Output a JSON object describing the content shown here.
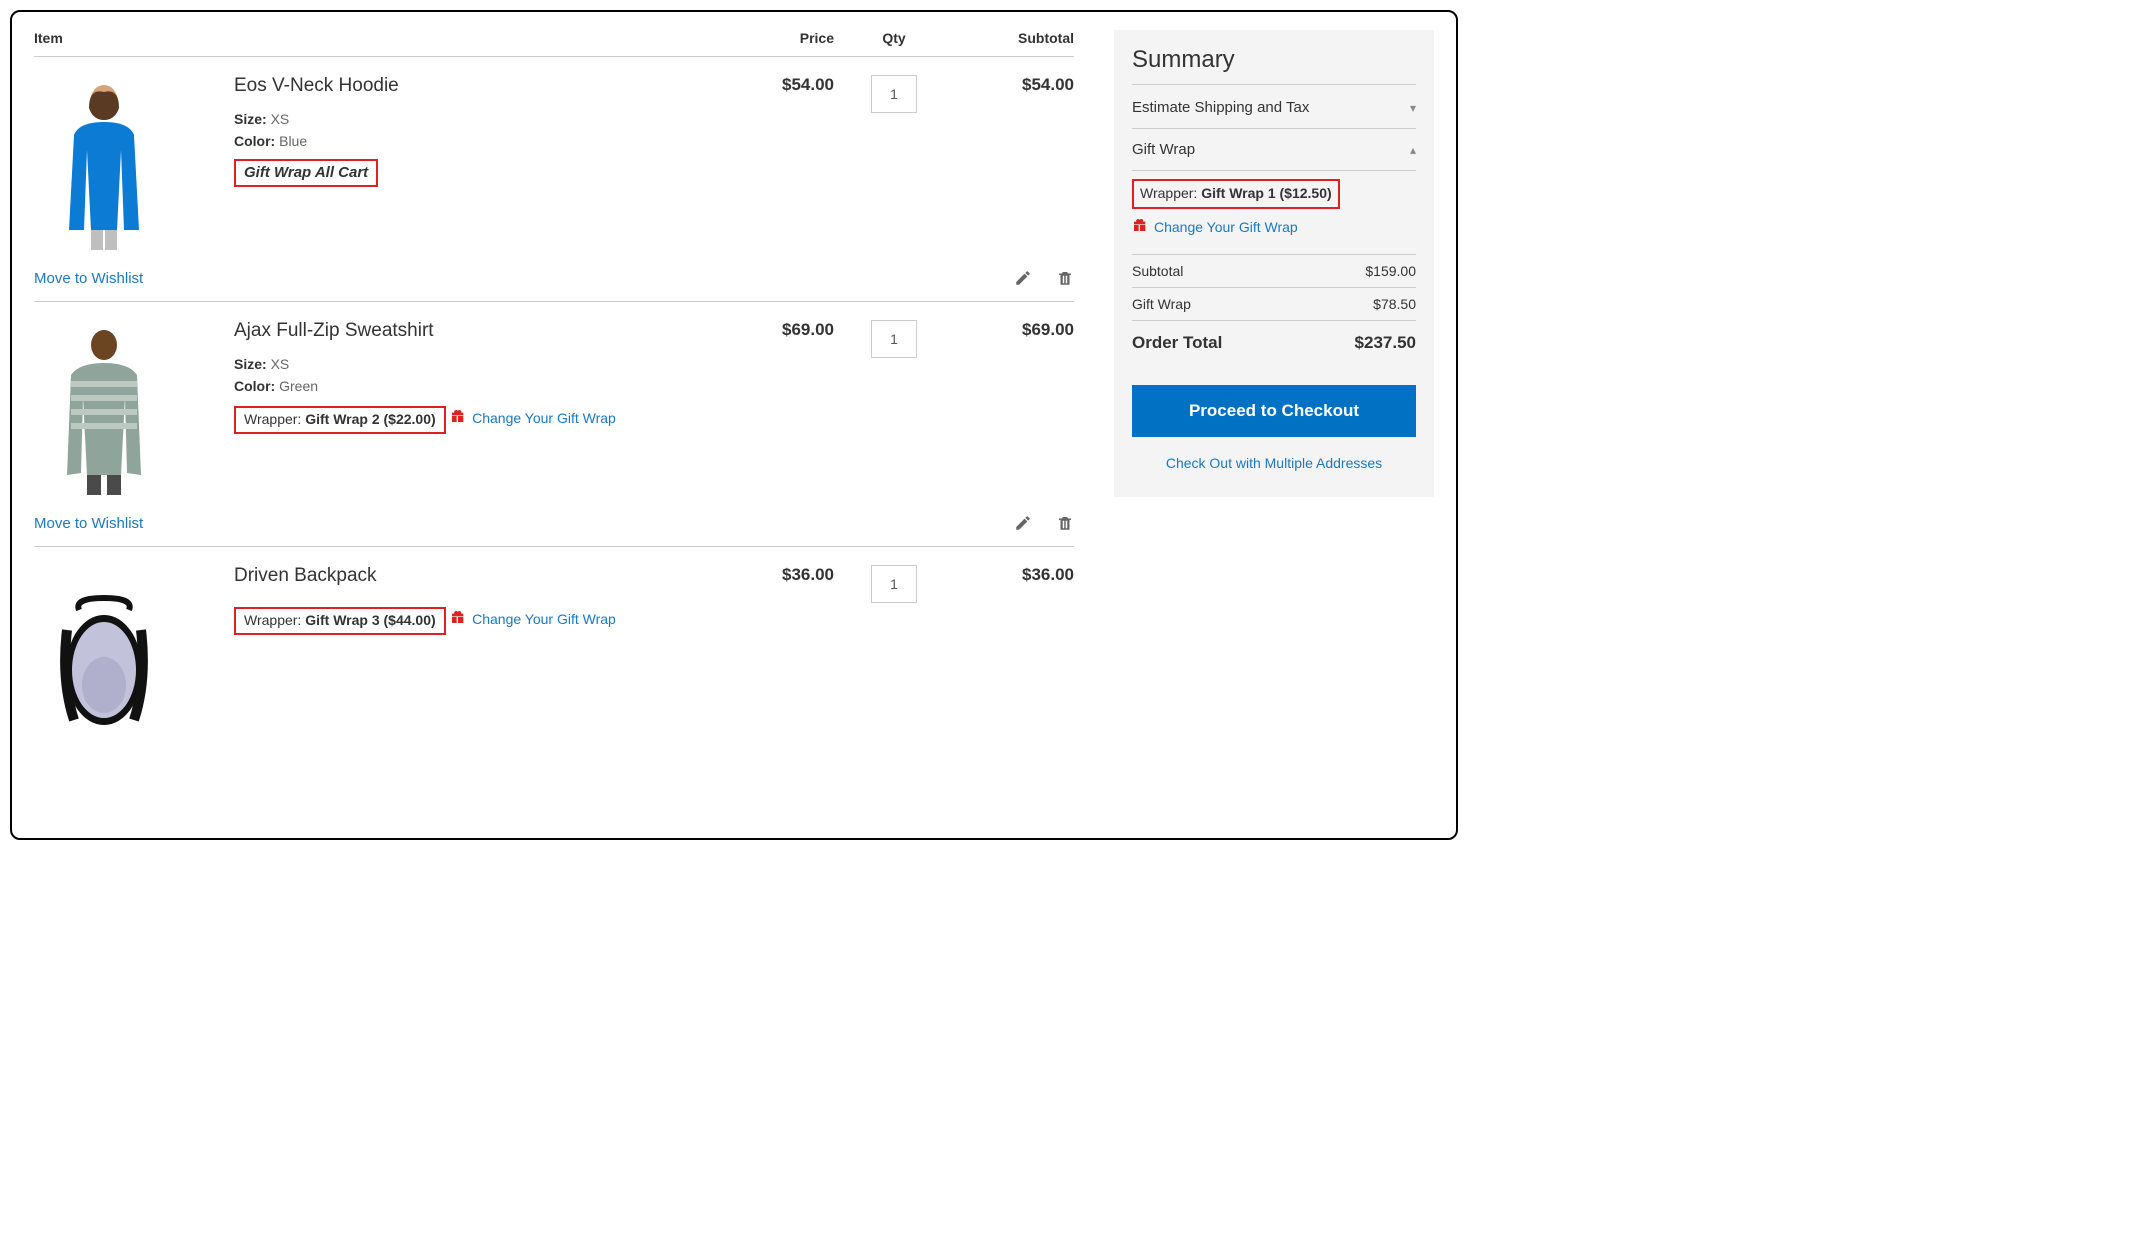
{
  "headers": {
    "item": "Item",
    "price": "Price",
    "qty": "Qty",
    "subtotal": "Subtotal"
  },
  "labels": {
    "size": "Size:",
    "color": "Color:",
    "wrapper": "Wrapper:",
    "change_gw": "Change Your Gift Wrap",
    "move_wishlist": "Move to Wishlist",
    "gw_all_cart": "Gift Wrap All Cart"
  },
  "items": [
    {
      "name": "Eos V-Neck Hoodie",
      "size": "XS",
      "color": "Blue",
      "price": "$54.00",
      "qty": "1",
      "subtotal": "$54.00",
      "show_gw_allcart": true,
      "show_wrapper": false,
      "wrapper_value": "",
      "show_actions": true
    },
    {
      "name": "Ajax Full-Zip Sweatshirt",
      "size": "XS",
      "color": "Green",
      "price": "$69.00",
      "qty": "1",
      "subtotal": "$69.00",
      "show_gw_allcart": false,
      "show_wrapper": true,
      "wrapper_value": "Gift Wrap 2 ($22.00)",
      "show_actions": true
    },
    {
      "name": "Driven Backpack",
      "size": "",
      "color": "",
      "price": "$36.00",
      "qty": "1",
      "subtotal": "$36.00",
      "show_gw_allcart": false,
      "show_wrapper": true,
      "wrapper_value": "Gift Wrap 3 ($44.00)",
      "show_actions": false
    }
  ],
  "summary": {
    "title": "Summary",
    "estimate_label": "Estimate Shipping and Tax",
    "giftwrap_label": "Gift Wrap",
    "wrapper_label": "Wrapper:",
    "wrapper_value": "Gift Wrap 1 ($12.50)",
    "change_gw": "Change Your Gift Wrap",
    "lines": [
      {
        "label": "Subtotal",
        "value": "$159.00"
      },
      {
        "label": "Gift Wrap",
        "value": "$78.50"
      }
    ],
    "order_total_label": "Order Total",
    "order_total_value": "$237.50",
    "checkout_btn": "Proceed to Checkout",
    "multi_addr": "Check Out with Multiple Addresses"
  }
}
